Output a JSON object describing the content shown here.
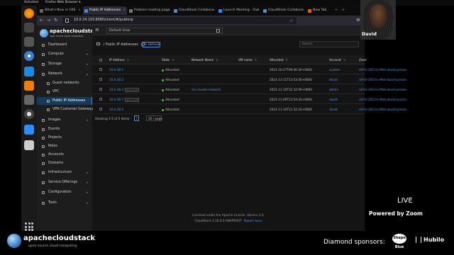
{
  "topbar": {
    "activities": "Activities",
    "app": "Firefox Web Browser ▾",
    "clock": "",
    "tray": ""
  },
  "browser": {
    "tabs": [
      {
        "label": "What's New in CKS",
        "active": false
      },
      {
        "label": "Public IP Addresses",
        "active": true
      },
      {
        "label": "Problem loading page",
        "active": false
      },
      {
        "label": "CloudStack Collabora",
        "active": false
      },
      {
        "label": "Launch Meeting - Zoo",
        "active": false
      },
      {
        "label": "CloudStack Collabora",
        "active": false
      },
      {
        "label": "New Tab",
        "active": false
      }
    ],
    "url": "10.0.34.193:8080/client/#/publicip"
  },
  "sidebar": {
    "brand": "apachecloudstack",
    "tagline": "open source cloud computing",
    "items": [
      {
        "label": "Dashboard"
      },
      {
        "label": "Compute"
      },
      {
        "label": "Storage"
      },
      {
        "label": "Network"
      },
      {
        "label": "Guest networks"
      },
      {
        "label": "VPC"
      },
      {
        "label": "Public IP Addresses"
      },
      {
        "label": "VPN Customer Gateway"
      },
      {
        "label": "Images"
      },
      {
        "label": "Events"
      },
      {
        "label": "Projects"
      },
      {
        "label": "Roles"
      },
      {
        "label": "Accounts"
      },
      {
        "label": "Domains"
      },
      {
        "label": "Infrastructure"
      },
      {
        "label": "Service Offerings"
      },
      {
        "label": "Configuration"
      },
      {
        "label": "Tools"
      }
    ]
  },
  "header": {
    "view": "Default View"
  },
  "page": {
    "title": "Public IP Addresses",
    "refresh": "Refresh",
    "search_placeholder": "Search"
  },
  "table": {
    "columns": [
      "IP Address",
      "State",
      "Network Name",
      "VM name",
      "Allocated",
      "Account",
      "Zone"
    ],
    "rows": [
      {
        "ip": "10.0.38.1",
        "tag": "",
        "state": "Allocated",
        "network": "",
        "vm": "",
        "allocated": "2021-10-27T09:40:30+0600",
        "account": "system",
        "zone": "ref-trl-2011-k-Mvb-david-jumam"
      },
      {
        "ip": "10.0.38.2",
        "tag": "",
        "state": "Allocated",
        "network": "",
        "vm": "",
        "allocated": "2021-11-11T13:53:56+0600",
        "account": "david",
        "zone": "ref-trl-2011-k-Mvb-david-jumam"
      },
      {
        "ip": "10.0.38.3",
        "tag": "source-nat",
        "state": "Allocated",
        "network": "cks-cluster-network",
        "vm": "",
        "allocated": "2021-11-10T11:32:59+0600",
        "account": "admin",
        "zone": "ref-trl-2011-k-Mvb-david-jumam"
      },
      {
        "ip": "10.0.38.7",
        "tag": "source-nat",
        "state": "Allocated",
        "network": "",
        "vm": "",
        "allocated": "2021-11-09T13:54:43+0600",
        "account": "david",
        "zone": "ref-trl-2011-k-Mvb-david-jumam"
      },
      {
        "ip": "10.0.38.5",
        "tag": "",
        "state": "Allocated",
        "network": "",
        "vm": "",
        "allocated": "2021-11-10T11:32:16+0600",
        "account": "david",
        "zone": "ref-trl-2011-k-Mvb-david-jumam"
      }
    ]
  },
  "pager": {
    "summary": "Showing 1-5 of 5 items",
    "page": "1",
    "size": "20 / page"
  },
  "footer": {
    "license": "Licensed under the Apache License, Version 2.0.",
    "version": "CloudStack 4.16.0.0-SNAPSHOT",
    "report": "Report issue"
  },
  "zoom": {
    "participant": "David",
    "live": "LIVE",
    "powered": "Powered by Zoom"
  },
  "banner": {
    "brand": "apachecloudstack",
    "tagline": "open source cloud computing",
    "sponsors": "Diamond sponsors:",
    "shape_top": "Shape",
    "shape_bottom": "Blue",
    "hubilo": "Hubilo"
  },
  "colors": {
    "accent": "#3b8ee8",
    "link": "#4e95e6",
    "success": "#52c41a",
    "selected_bg": "#163a5c"
  }
}
